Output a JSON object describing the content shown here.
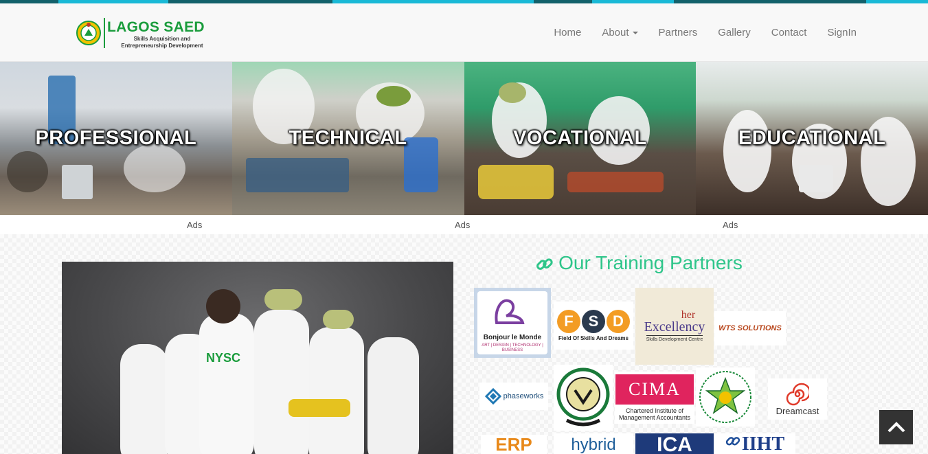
{
  "brand": {
    "name": "LAGOS SAED",
    "tagline_1": "Skills Acquisition and",
    "tagline_2": "Entrepreneurship Development"
  },
  "nav": {
    "items": [
      "Home",
      "About",
      "Partners",
      "Gallery",
      "Contact",
      "SignIn"
    ]
  },
  "categories": [
    "PROFESSIONAL",
    "TECHNICAL",
    "VOCATIONAL",
    "EDUCATIONAL"
  ],
  "ads": [
    "Ads",
    "Ads",
    "Ads"
  ],
  "partners": {
    "title": "Our Training Partners",
    "logos": {
      "bonjour": {
        "name": "Bonjour le Monde",
        "sub": "ART | DESIGN | TECHNOLOGY | BUSINESS"
      },
      "fsd": {
        "letters": "FSD",
        "name": "Field Of Skills And Dreams"
      },
      "her": {
        "top": "her",
        "name": "Excellency",
        "sub": "Skills Development Centre"
      },
      "wts": {
        "name": "WTS SOLUTIONS"
      },
      "phaseworks": {
        "name": "phaseworks"
      },
      "cima": {
        "mark": "CIMA",
        "name_1": "Chartered Institute of",
        "name_2": "Management Accountants"
      },
      "dreamcast": {
        "name": "Dreamcast"
      },
      "erp": {
        "name": "ERP"
      },
      "hybrid": {
        "name": "hybrid"
      },
      "ica": {
        "name": "ICA"
      },
      "iiht": {
        "name": "IIHT"
      }
    }
  },
  "hero": {
    "badge": "NYSC"
  },
  "colors": {
    "accent": "#2ec58a",
    "brand_green": "#1a9c3c",
    "strip_teal": "#13616b",
    "strip_cyan": "#19b9d6"
  },
  "icons": {
    "link": "link-icon",
    "back_to_top": "chevron-up-icon"
  }
}
